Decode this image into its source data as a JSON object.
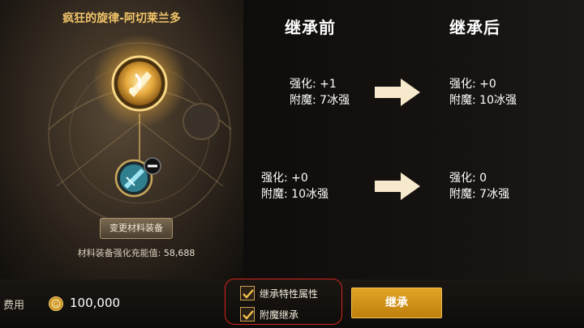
{
  "item": {
    "name": "疯狂的旋律-阿切莱兰多",
    "change_material_label": "变更材料装备",
    "charge_label": "材料装备强化充能值:",
    "charge_value": "58,688"
  },
  "columns": {
    "before_title": "继承前",
    "after_title": "继承后"
  },
  "rows": [
    {
      "before": {
        "enhance_label": "强化:",
        "enhance_value": "+1",
        "enchant_label": "附魔:",
        "enchant_value": "7冰强"
      },
      "after": {
        "enhance_label": "强化:",
        "enhance_value": "+0",
        "enchant_label": "附魔:",
        "enchant_value": "10冰强"
      }
    },
    {
      "before": {
        "enhance_label": "强化:",
        "enhance_value": "+0",
        "enchant_label": "附魔:",
        "enchant_value": "10冰强"
      },
      "after": {
        "enhance_label": "强化:",
        "enhance_value": "0",
        "enchant_label": "附魔:",
        "enchant_value": "7冰强"
      }
    }
  ],
  "footer": {
    "cost_label": "费用",
    "cost_value": "100,000",
    "option_trait": "继承特性属性",
    "option_enchant": "附魔继承",
    "inherit_button": "继承"
  },
  "icons": {
    "main_item": "music-note-weapon-icon",
    "material_item": "material-equipment-icon",
    "remove": "minus-icon",
    "coin": "gold-coin-icon",
    "arrow": "right-arrow-icon"
  },
  "colors": {
    "accent_gold": "#f2c46a",
    "button_orange": "#d9961c",
    "highlight_red": "#d4231e"
  }
}
